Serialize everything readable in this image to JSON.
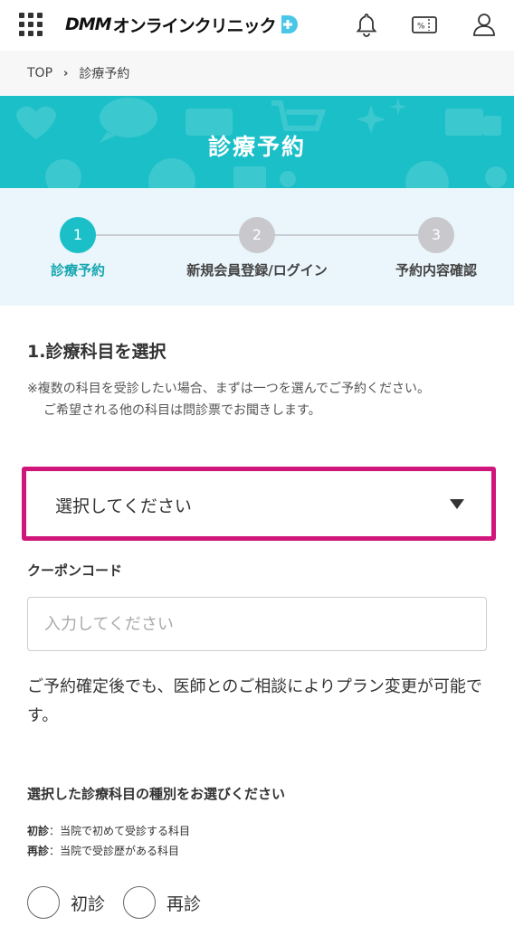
{
  "header": {
    "logo_brand": "DMM",
    "logo_text": "オンラインクリニック",
    "icons": [
      "menu-grid-icon",
      "bell-icon",
      "coupon-icon",
      "user-icon"
    ]
  },
  "breadcrumb": {
    "home": "TOP",
    "current": "診療予約"
  },
  "banner": {
    "title": "診療予約",
    "color": "#1bbfc8"
  },
  "steps": [
    {
      "number": "1",
      "label": "診療予約",
      "active": true
    },
    {
      "number": "2",
      "label": "新規会員登録/ログイン",
      "active": false
    },
    {
      "number": "3",
      "label": "予約内容確認",
      "active": false
    }
  ],
  "form": {
    "section_title": "1.診療科目を選択",
    "note_line1": "※複数の科目を受診したい場合、まずは一つを選んでご予約ください。",
    "note_line2": "ご希望される他の科目は問診票でお聞きします。",
    "select_value": "選択してください",
    "coupon_label": "クーポンコード",
    "coupon_placeholder": "入力してください",
    "plan_note": "ご予約確定後でも、医師とのご相談によりプラン変更が可能です。",
    "type_title": "選択した診療科目の種別をお選びください",
    "first_term": "初診",
    "first_desc": "：当院で初めて受診する科目",
    "re_term": "再診",
    "re_desc": "：当院で受診歴がある科目",
    "radio_first": "初診",
    "radio_re": "再診"
  },
  "colors": {
    "accent": "#1bbfc8",
    "highlight": "#d0167a"
  }
}
